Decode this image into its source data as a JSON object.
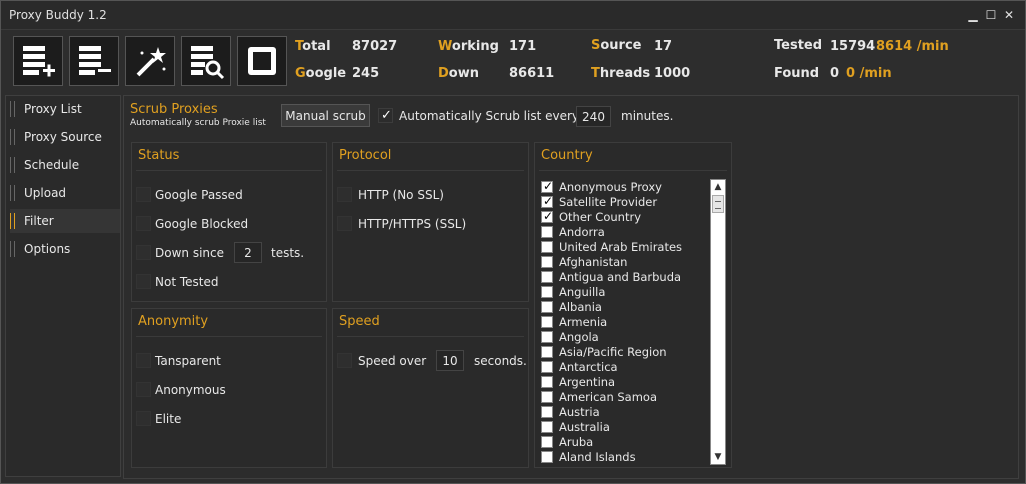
{
  "window": {
    "title": "Proxy Buddy 1.2"
  },
  "stats": {
    "total": {
      "first": "T",
      "rest": "otal",
      "value": "87027"
    },
    "google": {
      "first": "G",
      "rest": "oogle",
      "value": "245"
    },
    "working": {
      "first": "W",
      "rest": "orking",
      "value": "171"
    },
    "down": {
      "first": "D",
      "rest": "own",
      "value": "86611"
    },
    "source": {
      "first": "S",
      "rest": "ource",
      "value": "17"
    },
    "threads": {
      "first": "T",
      "rest": "hreads",
      "value": "1000"
    },
    "tested": {
      "label": "Tested",
      "value": "15794",
      "rate": "8614 /min"
    },
    "found": {
      "label": "Found",
      "value": "0",
      "rate": "0 /min"
    }
  },
  "sidebar": {
    "items": [
      {
        "label": "Proxy List",
        "active": false
      },
      {
        "label": "Proxy Source",
        "active": false
      },
      {
        "label": "Schedule",
        "active": false
      },
      {
        "label": "Upload",
        "active": false
      },
      {
        "label": "Filter",
        "active": true
      },
      {
        "label": "Options",
        "active": false
      }
    ]
  },
  "scrub": {
    "title": "Scrub Proxies",
    "subtitle": "Automatically scrub Proxie list",
    "manual_button": "Manual scrub",
    "auto_label": "Automatically Scrub list every",
    "auto_checked": true,
    "interval": "240",
    "unit": "minutes."
  },
  "status": {
    "title": "Status",
    "google_passed": "Google Passed",
    "google_blocked": "Google Blocked",
    "down_since": "Down since",
    "down_value": "2",
    "down_unit": "tests.",
    "not_tested": "Not Tested"
  },
  "protocol": {
    "title": "Protocol",
    "http": "HTTP (No SSL)",
    "https": "HTTP/HTTPS (SSL)"
  },
  "anonymity": {
    "title": "Anonymity",
    "transparent": "Tansparent",
    "anonymous": "Anonymous",
    "elite": "Elite"
  },
  "speed": {
    "title": "Speed",
    "label": "Speed over",
    "value": "10",
    "unit": "seconds."
  },
  "country": {
    "title": "Country",
    "items": [
      {
        "label": "Anonymous Proxy",
        "checked": true
      },
      {
        "label": "Satellite Provider",
        "checked": true
      },
      {
        "label": "Other Country",
        "checked": true
      },
      {
        "label": "Andorra",
        "checked": false
      },
      {
        "label": "United Arab Emirates",
        "checked": false
      },
      {
        "label": "Afghanistan",
        "checked": false
      },
      {
        "label": "Antigua and Barbuda",
        "checked": false
      },
      {
        "label": "Anguilla",
        "checked": false
      },
      {
        "label": "Albania",
        "checked": false
      },
      {
        "label": "Armenia",
        "checked": false
      },
      {
        "label": "Angola",
        "checked": false
      },
      {
        "label": "Asia/Pacific Region",
        "checked": false
      },
      {
        "label": "Antarctica",
        "checked": false
      },
      {
        "label": "Argentina",
        "checked": false
      },
      {
        "label": "American Samoa",
        "checked": false
      },
      {
        "label": "Austria",
        "checked": false
      },
      {
        "label": "Australia",
        "checked": false
      },
      {
        "label": "Aruba",
        "checked": false
      },
      {
        "label": "Aland Islands",
        "checked": false
      }
    ]
  },
  "colors": {
    "accent": "#e0a020",
    "background": "#2b2b2b"
  }
}
